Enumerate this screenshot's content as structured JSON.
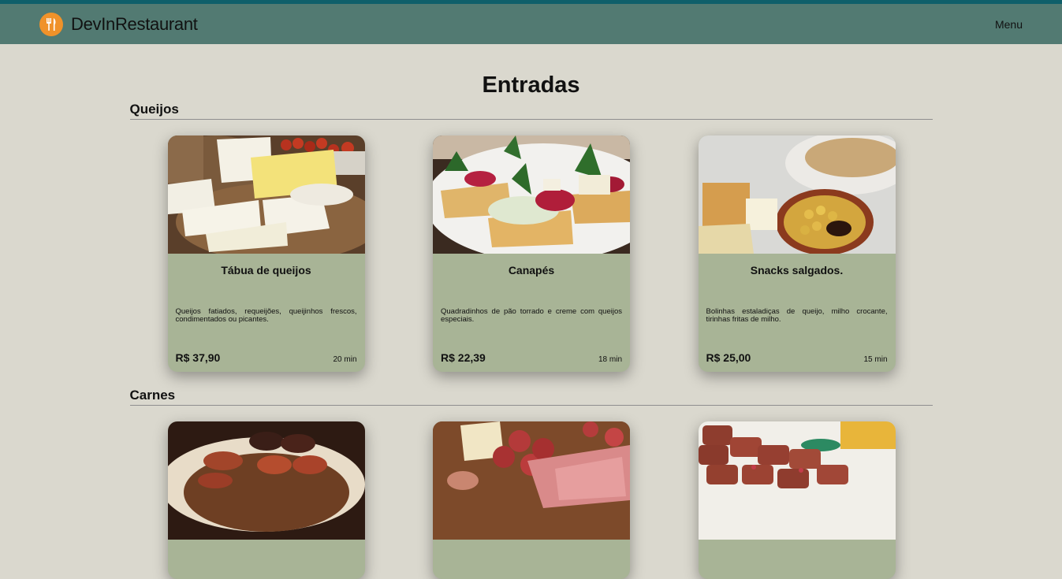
{
  "navbar": {
    "brand": "DevInRestaurant",
    "logo_icon": "fork-knife-icon",
    "menu_label": "Menu",
    "colors": {
      "bar": "#527a72",
      "topline": "#0f5f6a",
      "logo": "#f0922a"
    }
  },
  "page": {
    "title": "Entradas",
    "background": "#dad8ce",
    "card_color": "#a8b496"
  },
  "sections": [
    {
      "title": "Queijos",
      "items": [
        {
          "name": "Tábua de queijos",
          "description": "Queijos fatiados, requeijões, queijinhos frescos, condimentados ou picantes.",
          "price": "R$ 37,90",
          "time": "20 min",
          "image": "cheese-board-photo"
        },
        {
          "name": "Canapés",
          "description": "Quadradinhos de pão torrado e creme com queijos especiais.",
          "price": "R$ 22,39",
          "time": "18 min",
          "image": "canapes-photo"
        },
        {
          "name": "Snacks salgados.",
          "description": "Bolinhas estaladiças de queijo, milho crocante, tirinhas fritas de milho.",
          "price": "R$ 25,00",
          "time": "15 min",
          "image": "salty-snacks-photo"
        }
      ]
    },
    {
      "title": "Carnes",
      "items": [
        {
          "image": "sausages-photo"
        },
        {
          "image": "cold-cuts-photo"
        },
        {
          "image": "meat-bites-photo"
        }
      ]
    }
  ]
}
